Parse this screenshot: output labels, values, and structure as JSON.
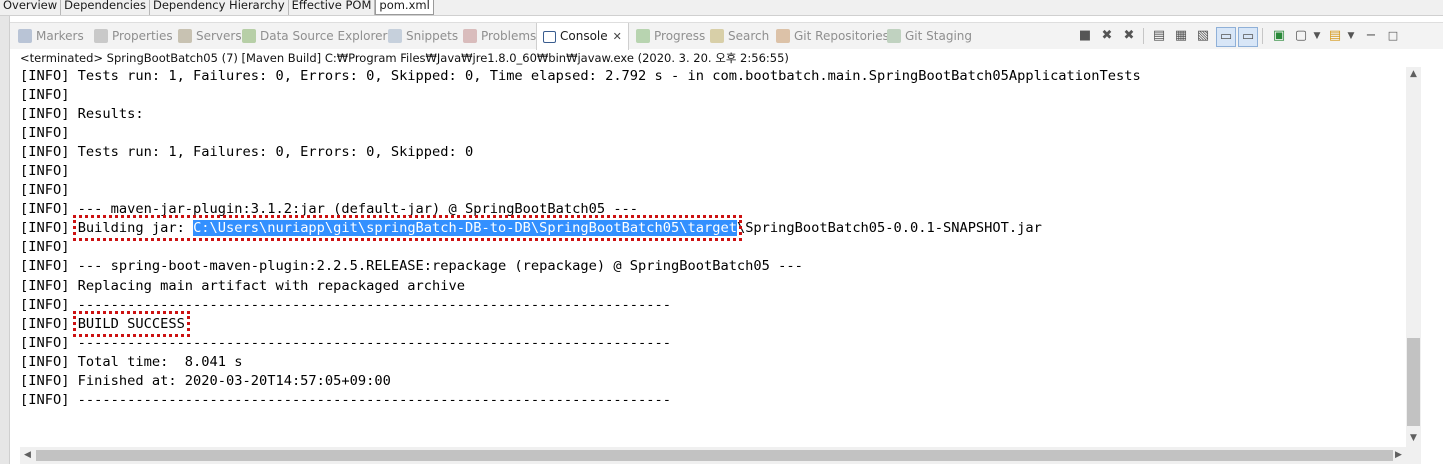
{
  "editor_tabs": [
    "Overview",
    "Dependencies",
    "Dependency Hierarchy",
    "Effective POM",
    "pom.xml"
  ],
  "view_tabs": [
    {
      "label": "Markers",
      "icon": "markers-icon"
    },
    {
      "label": "Properties",
      "icon": "properties-icon"
    },
    {
      "label": "Servers",
      "icon": "servers-icon"
    },
    {
      "label": "Data Source Explorer",
      "icon": "data-source-icon"
    },
    {
      "label": "Snippets",
      "icon": "snippets-icon"
    },
    {
      "label": "Problems",
      "icon": "problems-icon"
    },
    {
      "label": "Console",
      "icon": "console-icon",
      "close": "✕"
    },
    {
      "label": "Progress",
      "icon": "progress-icon"
    },
    {
      "label": "Search",
      "icon": "search-icon"
    },
    {
      "label": "Git Repositories",
      "icon": "git-repositories-icon"
    },
    {
      "label": "Git Staging",
      "icon": "git-staging-icon"
    }
  ],
  "status": "<terminated> SpringBootBatch05 (7) [Maven Build] C:₩Program Files₩Java₩jre1.8.0_60₩bin₩javaw.exe (2020. 3. 20. 오후 2:56:55)",
  "console_lines": [
    "[INFO] Tests run: 1, Failures: 0, Errors: 0, Skipped: 0, Time elapsed: 2.792 s - in com.bootbatch.main.SpringBootBatch05ApplicationTests",
    "[INFO]",
    "[INFO] Results:",
    "[INFO]",
    "[INFO] Tests run: 1, Failures: 0, Errors: 0, Skipped: 0",
    "[INFO]",
    "[INFO]",
    "[INFO] --- maven-jar-plugin:3.1.2:jar (default-jar) @ SpringBootBatch05 ---"
  ],
  "jar_line": {
    "prefix": "[INFO] ",
    "label": "Building jar: ",
    "selected_path": "C:\\Users\\nuriapp\\git\\springBatch-DB-to-DB\\SpringBootBatch05\\target",
    "rest": "\\SpringBootBatch05-0.0.1-SNAPSHOT.jar"
  },
  "console_lines_2": [
    "[INFO]",
    "[INFO] --- spring-boot-maven-plugin:2.2.5.RELEASE:repackage (repackage) @ SpringBootBatch05 ---",
    "[INFO] Replacing main artifact with repackaged archive",
    "[INFO] ------------------------------------------------------------------------"
  ],
  "build_line": {
    "prefix": "[INFO] ",
    "text": "BUILD SUCCESS"
  },
  "console_lines_3": [
    "[INFO] ------------------------------------------------------------------------",
    "[INFO] Total time:  8.041 s",
    "[INFO] Finished at: 2020-03-20T14:57:05+09:00",
    "[INFO] ------------------------------------------------------------------------"
  ],
  "toolbar_icons": [
    "stop-icon",
    "remove-launch-icon",
    "remove-all-icon",
    "clear-console-icon",
    "scroll-lock-icon",
    "word-wrap-icon",
    "show-stdout-icon",
    "show-stderr-icon",
    "pin-console-icon",
    "display-console-icon",
    "open-console-icon",
    "minimize-icon",
    "maximize-icon"
  ],
  "highlight_color": "#3390ff",
  "annotation_color": "#cc1111"
}
